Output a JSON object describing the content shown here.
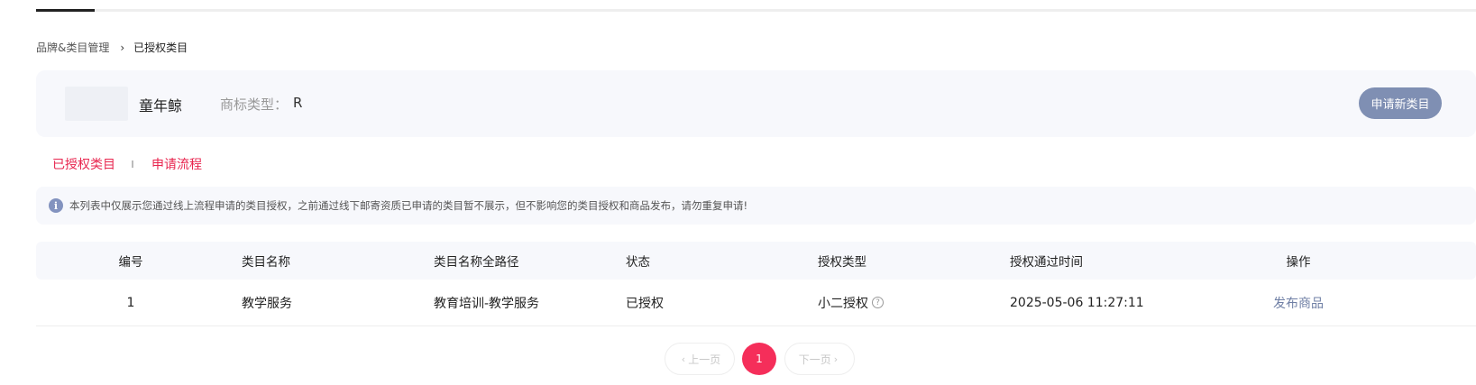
{
  "breadcrumb": {
    "parent": "品牌&类目管理",
    "separator": "›",
    "current": "已授权类目"
  },
  "brand": {
    "name": "童年鲸",
    "trademark_label": "商标类型：",
    "trademark_value": "R",
    "apply_button": "申请新类目"
  },
  "tabs": [
    {
      "label": "已授权类目"
    },
    {
      "label": "申请流程"
    }
  ],
  "notice": {
    "icon": "info-icon",
    "icon_glyph": "i",
    "text": "本列表中仅展示您通过线上流程申请的类目授权，之前通过线下邮寄资质已申请的类目暂不展示，但不影响您的类目授权和商品发布，请勿重复申请!"
  },
  "table": {
    "columns": [
      "编号",
      "类目名称",
      "类目名称全路径",
      "状态",
      "授权类型",
      "授权通过时间",
      "操作"
    ],
    "rows": [
      {
        "id": "1",
        "category": "教学服务",
        "full_path": "教育培训-教学服务",
        "status": "已授权",
        "auth_type": "小二授权",
        "auth_time": "2025-05-06 11:27:11",
        "action": "发布商品"
      }
    ]
  },
  "pagination": {
    "prev_label": "上一页",
    "next_label": "下一页",
    "current_page": "1"
  },
  "colors": {
    "accent": "#f52e5a",
    "tab_text": "#e8264f",
    "button": "#7f8fb3",
    "link": "#6f7fa5",
    "panel_bg": "#f7f8fc"
  }
}
